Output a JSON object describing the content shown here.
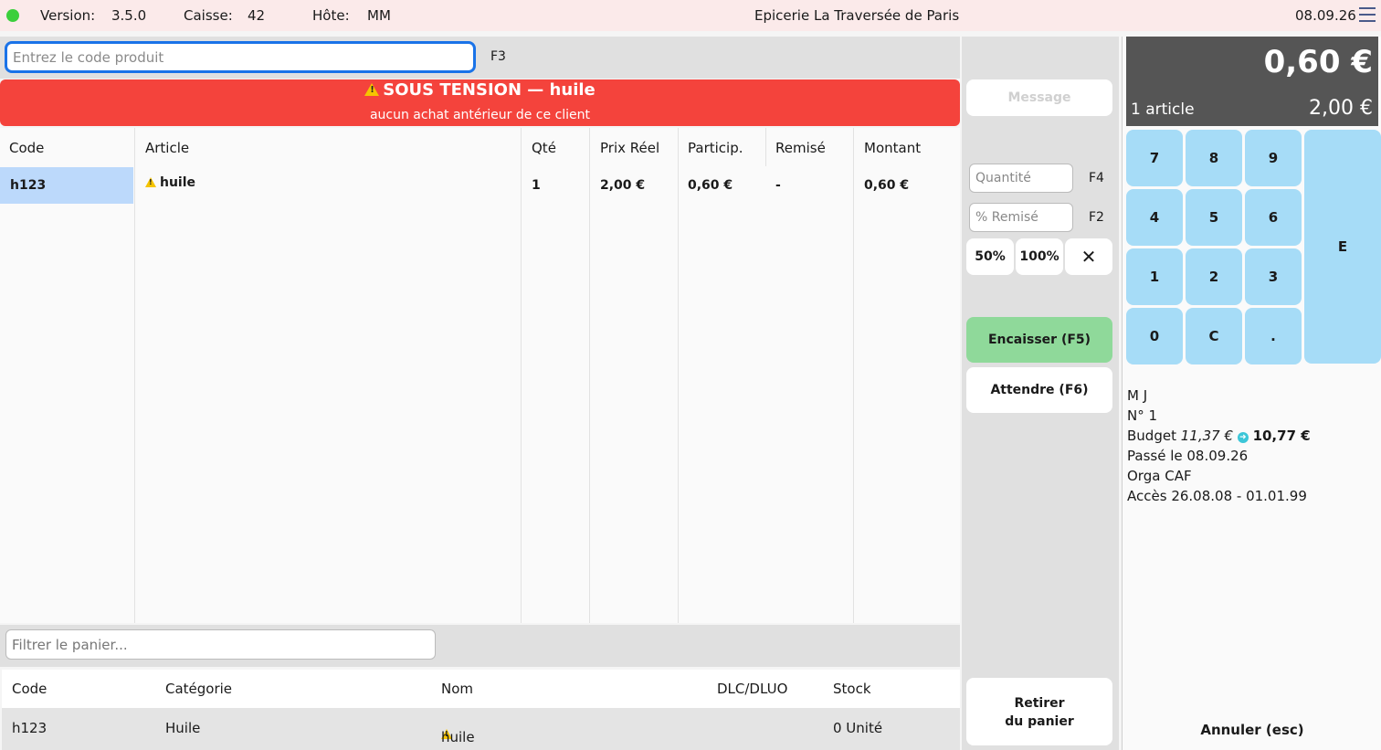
{
  "topbar": {
    "version_label": "Version:",
    "version": "3.5.0",
    "register_label": "Caisse:",
    "register": "42",
    "host_label": "Hôte:",
    "host": "MM",
    "shop_name": "Epicerie La Traversée de Paris",
    "date": "08.09.26"
  },
  "code_entry": {
    "placeholder": "Entrez le code produit",
    "shortcut": "F3"
  },
  "alert": {
    "title": "SOUS TENSION — huile",
    "subtitle": "aucun achat antérieur de ce client",
    "color": "#f4433c"
  },
  "cart": {
    "headers": [
      "Code",
      "Article",
      "Qté",
      "Prix Réel",
      "Particip.",
      "Remisé",
      "Montant"
    ],
    "rows": [
      {
        "code": "h123",
        "article": "huile",
        "qty": "1",
        "real_price": "2,00 €",
        "particip": "0,60 €",
        "discount": "-",
        "amount": "0,60 €"
      }
    ]
  },
  "filter": {
    "placeholder": "Filtrer le panier..."
  },
  "stock": {
    "headers": [
      "Code",
      "Catégorie",
      "Nom",
      "DLC/DLUO",
      "Stock"
    ],
    "rows": [
      {
        "code": "h123",
        "category": "Huile",
        "name": "huile",
        "dlc": "",
        "stock": "0 Unité"
      }
    ]
  },
  "controls": {
    "message": "Message",
    "qty_placeholder": "Quantité",
    "qty_key": "F4",
    "discount_placeholder": "% Remisé",
    "discount_key": "F2",
    "pct_50": "50%",
    "pct_100": "100%",
    "clear": "✕",
    "cash": "Encaisser  (F5)",
    "wait": "Attendre  (F6)",
    "remove_line1": "Retirer",
    "remove_line2": "du panier"
  },
  "totals": {
    "total": "0,60 €",
    "count": "1 article",
    "real_total": "2,00 €"
  },
  "keypad": {
    "k7": "7",
    "k8": "8",
    "k9": "9",
    "k4": "4",
    "k5": "5",
    "k6": "6",
    "k1": "1",
    "k2": "2",
    "k3": "3",
    "k0": "0",
    "kc": "C",
    "kdot": ".",
    "ke": "E"
  },
  "client": {
    "name": "M J",
    "number": "N° 1",
    "budget_label": "Budget",
    "budget_before": "11,37 €",
    "budget_after": "10,77 €",
    "passed_label": "Passé le",
    "passed": "08.09.26",
    "orga_label": "Orga",
    "orga": "CAF",
    "access_label": "Accès",
    "access": "26.08.08 - 01.01.99"
  },
  "cancel": "Annuler  (esc)"
}
